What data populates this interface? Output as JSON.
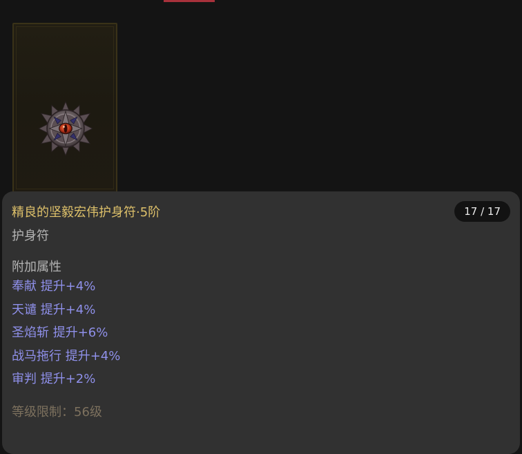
{
  "item": {
    "icon": "amulet-icon",
    "title": "精良的坚毅宏伟护身符·5阶",
    "counter": "17 / 17",
    "type": "护身符",
    "section_heading": "附加属性",
    "stats": [
      "奉献 提升+4%",
      "天谴 提升+4%",
      "圣焰斩 提升+6%",
      "战马拖行 提升+4%",
      "审判 提升+2%"
    ],
    "level_requirement": "等级限制：56级"
  },
  "colors": {
    "title": "#ddc06a",
    "stat": "#8f90ea",
    "muted": "#b4b4b4",
    "requirement": "#7d715e",
    "accent": "#a8313b"
  }
}
